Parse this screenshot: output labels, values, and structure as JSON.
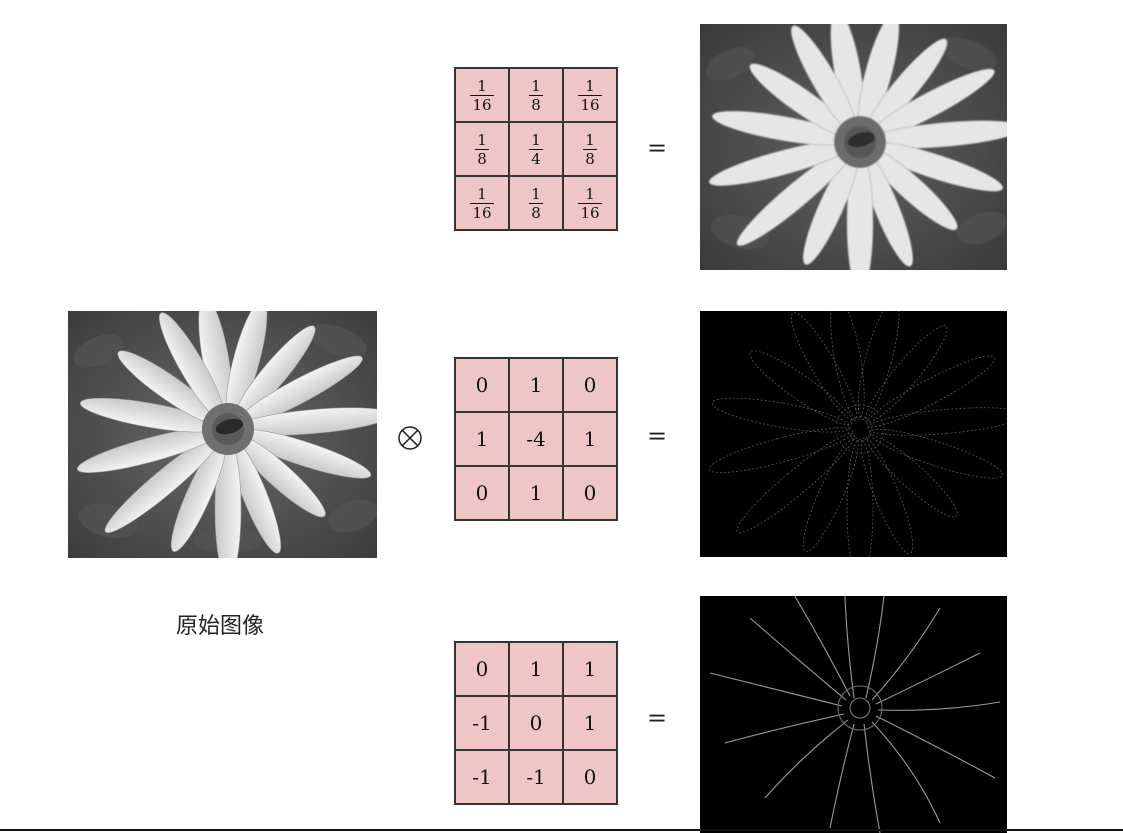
{
  "caption": "原始图像",
  "operator_symbol": "⊗",
  "equals_sign": "=",
  "kernels": {
    "blur": {
      "cells": [
        {
          "num": "1",
          "den": "16"
        },
        {
          "num": "1",
          "den": "8"
        },
        {
          "num": "1",
          "den": "16"
        },
        {
          "num": "1",
          "den": "8"
        },
        {
          "num": "1",
          "den": "4"
        },
        {
          "num": "1",
          "den": "8"
        },
        {
          "num": "1",
          "den": "16"
        },
        {
          "num": "1",
          "den": "8"
        },
        {
          "num": "1",
          "den": "16"
        }
      ]
    },
    "laplacian": {
      "cells": [
        "0",
        "1",
        "0",
        "1",
        "-4",
        "1",
        "0",
        "1",
        "0"
      ]
    },
    "emboss": {
      "cells": [
        "0",
        "1",
        "1",
        "-1",
        "0",
        "1",
        "-1",
        "-1",
        "0"
      ]
    }
  },
  "colors": {
    "kernel_fill": "#efc6c6",
    "grid_line": "#333333"
  },
  "images": {
    "original": "original-grayscale-daisy-photo",
    "blur_output": "blurred-daisy-photo",
    "laplacian_output": "edge-detected-daisy-photo",
    "emboss_output": "embossed-edge-daisy-photo"
  }
}
